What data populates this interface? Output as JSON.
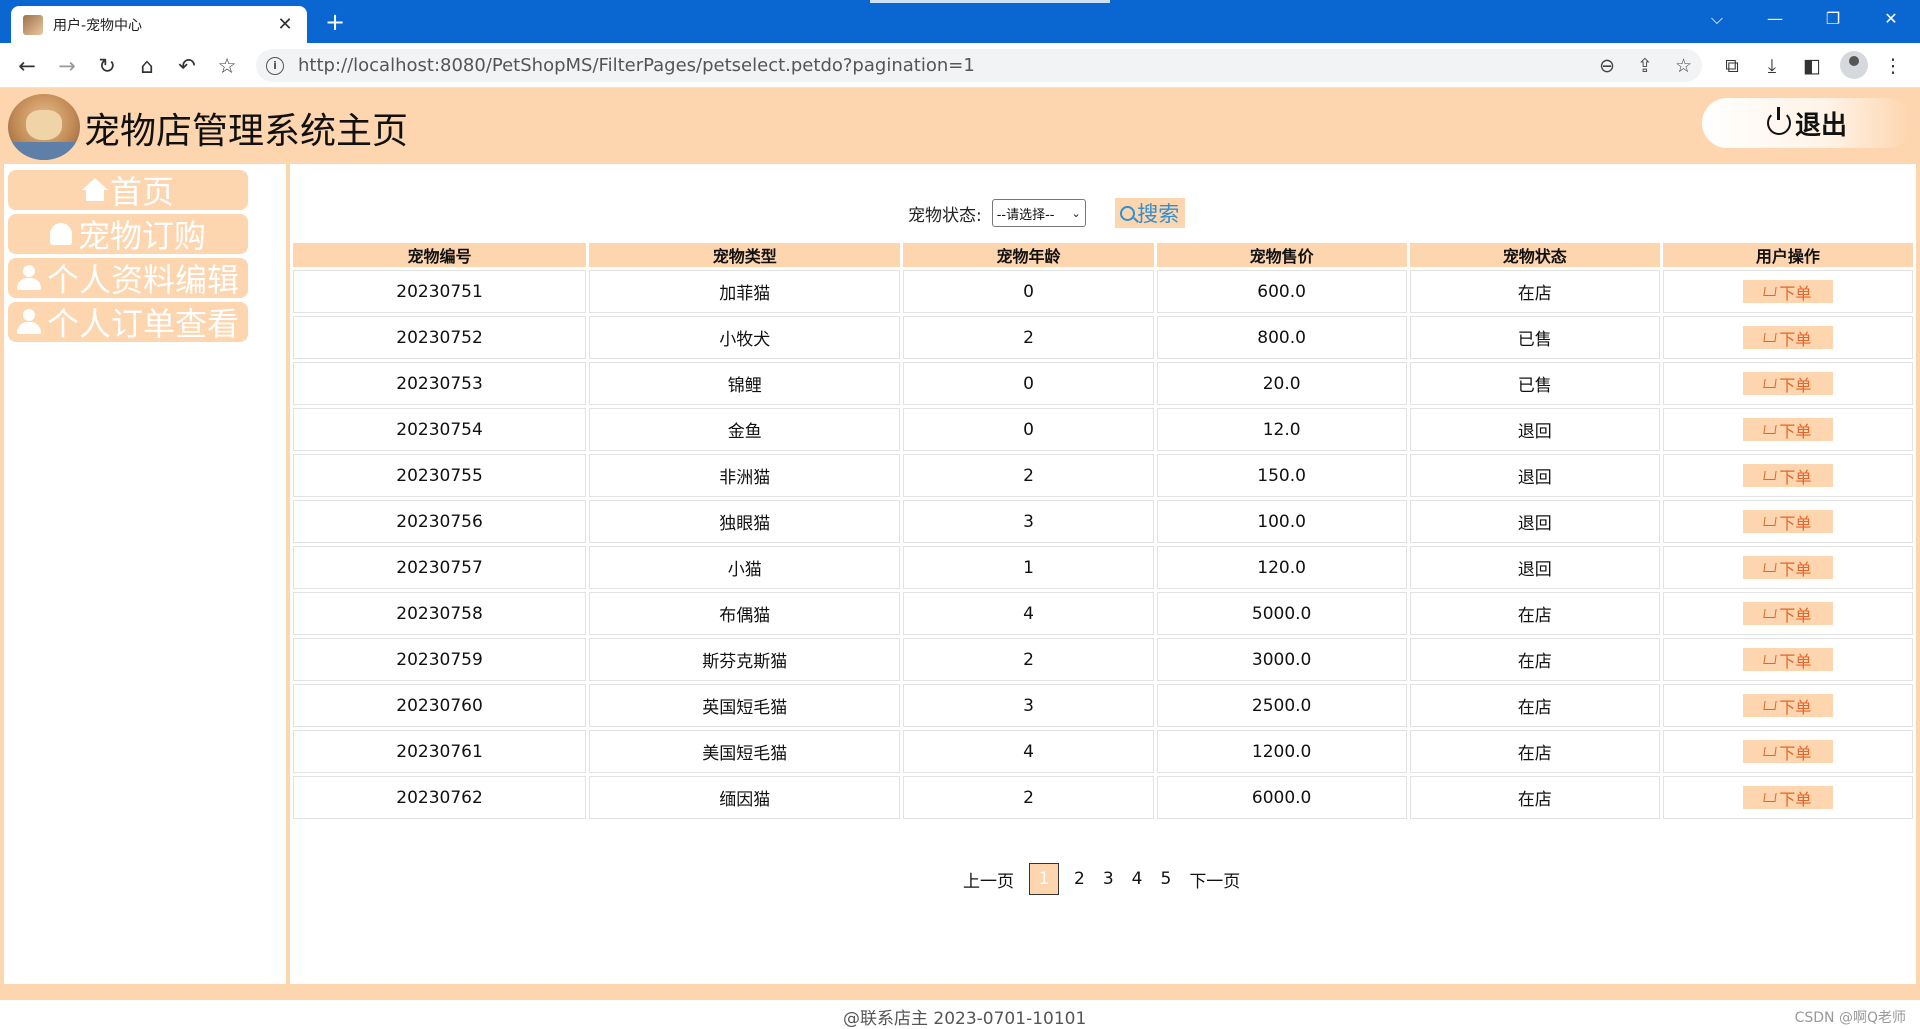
{
  "browser": {
    "tab_title": "用户-宠物中心",
    "tab_close": "✕",
    "new_tab": "+",
    "url_host": "http://localhost",
    "url_rest": ":8080/PetShopMS/FilterPages/petselect.petdo?pagination=1",
    "window_buttons": [
      "⌵",
      "—",
      "❐",
      "✕"
    ],
    "nav_icons": [
      "←",
      "→",
      "↻",
      "⌂",
      "↶",
      "☆"
    ],
    "addr_icons": [
      "⊖",
      "⇪",
      "☆"
    ],
    "right_icons": [
      "⧉",
      "⤓",
      "◧",
      "⋮"
    ]
  },
  "header": {
    "title": "宠物店管理系统主页",
    "logout_label": "退出"
  },
  "sidebar": {
    "items": [
      {
        "label": "首页",
        "icon": "home-icon"
      },
      {
        "label": "宠物订购",
        "icon": "bell-icon"
      },
      {
        "label": "个人资料编辑",
        "icon": "user-icon"
      },
      {
        "label": "个人订单查看",
        "icon": "user-icon"
      }
    ]
  },
  "filter": {
    "label": "宠物状态:",
    "select_value": "--请选择--",
    "search_label": "搜索"
  },
  "table": {
    "headers": [
      "宠物编号",
      "宠物类型",
      "宠物年龄",
      "宠物售价",
      "宠物状态",
      "用户操作"
    ],
    "order_label": "下单",
    "rows": [
      [
        "20230751",
        "加菲猫",
        "0",
        "600.0",
        "在店"
      ],
      [
        "20230752",
        "小牧犬",
        "2",
        "800.0",
        "已售"
      ],
      [
        "20230753",
        "锦鲤",
        "0",
        "20.0",
        "已售"
      ],
      [
        "20230754",
        "金鱼",
        "0",
        "12.0",
        "退回"
      ],
      [
        "20230755",
        "非洲猫",
        "2",
        "150.0",
        "退回"
      ],
      [
        "20230756",
        "独眼猫",
        "3",
        "100.0",
        "退回"
      ],
      [
        "20230757",
        "小猫",
        "1",
        "120.0",
        "退回"
      ],
      [
        "20230758",
        "布偶猫",
        "4",
        "5000.0",
        "在店"
      ],
      [
        "20230759",
        "斯芬克斯猫",
        "2",
        "3000.0",
        "在店"
      ],
      [
        "20230760",
        "英国短毛猫",
        "3",
        "2500.0",
        "在店"
      ],
      [
        "20230761",
        "美国短毛猫",
        "4",
        "1200.0",
        "在店"
      ],
      [
        "20230762",
        "缅因猫",
        "2",
        "6000.0",
        "在店"
      ]
    ]
  },
  "pager": {
    "prev": "上一页",
    "current": "1",
    "pages": [
      "2",
      "3",
      "4",
      "5"
    ],
    "next": "下一页"
  },
  "footer": {
    "text": "@联系店主 2023-0701-10101",
    "watermark": "CSDN @啊Q老师"
  },
  "colors": {
    "accent": "#fdd5ae",
    "browser_blue": "#0a66d0",
    "order_text": "#e8642a",
    "search_text": "#2f8fd0"
  }
}
